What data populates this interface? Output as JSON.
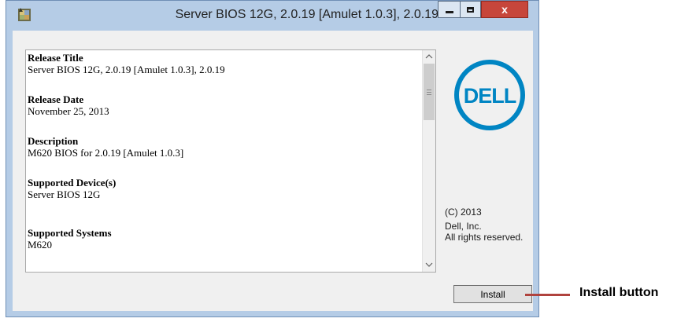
{
  "window": {
    "title": "Server BIOS 12G, 2.0.19 [Amulet 1.0.3], 2.0.19",
    "icon": "dell-update-package-icon",
    "controls": {
      "minimize": "minimize-icon",
      "maximize": "maximize-icon",
      "close_label": "x"
    }
  },
  "release_info": [
    {
      "heading": "Release Title",
      "value": "Server BIOS 12G, 2.0.19 [Amulet 1.0.3], 2.0.19"
    },
    {
      "heading": "Release Date",
      "value": "November 25, 2013"
    },
    {
      "heading": "Description",
      "value": "M620 BIOS for 2.0.19 [Amulet 1.0.3]"
    },
    {
      "heading": "Supported Device(s)",
      "value": "Server BIOS 12G"
    },
    {
      "heading": "Supported Systems",
      "value": "M620"
    }
  ],
  "scrollbar": {
    "up_arrow": "^",
    "down_arrow": "v"
  },
  "logo": {
    "text": "DELL",
    "color": "#0085c3"
  },
  "copyright": {
    "line1": "(C) 2013",
    "line2": "Dell, Inc.",
    "line3": "All rights reserved."
  },
  "install_button": {
    "label": "Install"
  },
  "annotation": {
    "label": "Install button",
    "line_color": "#b0433e"
  }
}
